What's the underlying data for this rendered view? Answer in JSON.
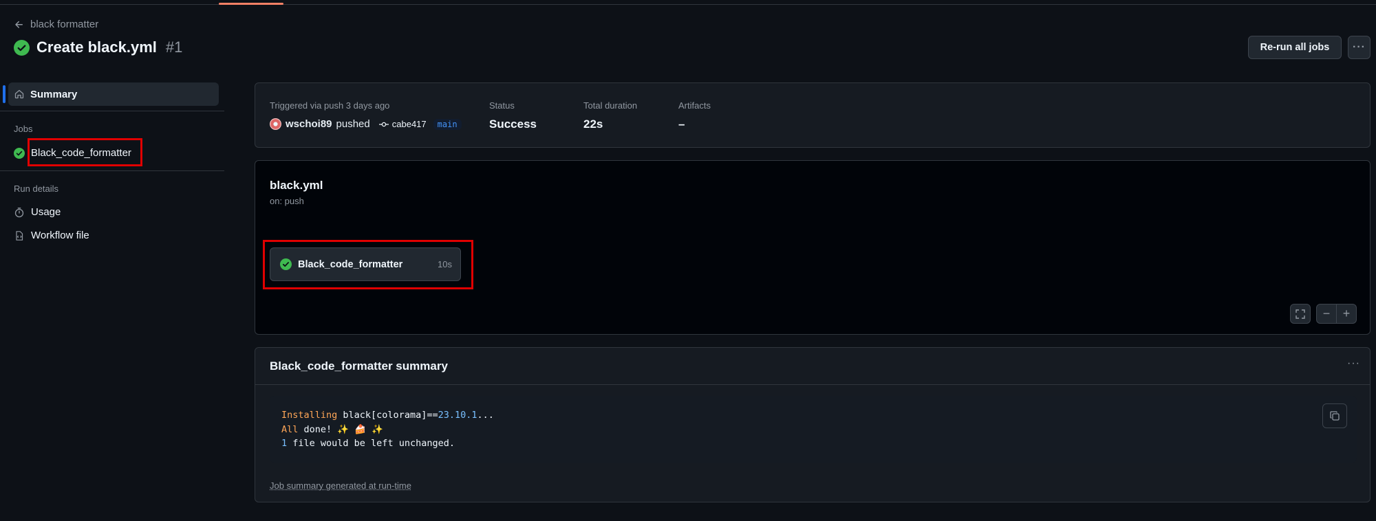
{
  "header": {
    "back_label": "black formatter",
    "title": "Create black.yml",
    "run_number": "#1",
    "rerun_label": "Re-run all jobs",
    "more_label": "···"
  },
  "sidebar": {
    "summary_label": "Summary",
    "jobs_heading": "Jobs",
    "job_label": "Black_code_formatter",
    "run_details_heading": "Run details",
    "usage_label": "Usage",
    "workflow_file_label": "Workflow file"
  },
  "info": {
    "trigger_label": "Triggered via push 3 days ago",
    "user": "wschoi89",
    "action": "pushed",
    "commit": "cabe417",
    "branch": "main",
    "status_label": "Status",
    "status_value": "Success",
    "duration_label": "Total duration",
    "duration_value": "22s",
    "artifacts_label": "Artifacts",
    "artifacts_value": "–"
  },
  "graph": {
    "workflow_name": "black.yml",
    "trigger": "on: push",
    "job_name": "Black_code_formatter",
    "job_duration": "10s"
  },
  "summary": {
    "title": "Black_code_formatter summary",
    "more_label": "···",
    "line1_kw": "Installing",
    "line1_a": " black[colorama]==",
    "line1_num": "23.10.1",
    "line1_b": "...",
    "line2_kw": "All",
    "line2_rest": " done! ✨ 🍰 ✨",
    "line3_num": "1",
    "line3_rest": " file would be left unchanged.",
    "footer": "Job summary generated at run-time"
  },
  "colors": {
    "success": "#3fb950",
    "accent": "#1f6feb",
    "highlight_box": "#e00000"
  }
}
